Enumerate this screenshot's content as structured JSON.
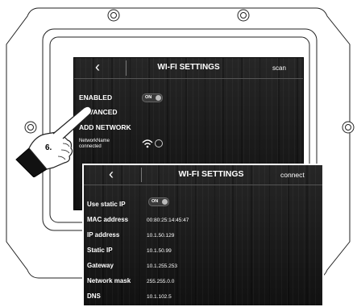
{
  "screen1": {
    "title": "WI-FI SETTINGS",
    "scan_label": "scan",
    "rows": {
      "enabled": "ENABLED",
      "advanced": "ADVANCED",
      "add_network": "ADD NETWORK",
      "network_name": "NetworkName",
      "connected": "connected"
    },
    "toggle_label": "ON"
  },
  "screen2": {
    "title": "WI-FI SETTINGS",
    "connect_label": "connect",
    "static_ip_label": "Use static IP",
    "toggle_label": "ON",
    "fields": [
      {
        "label": "MAC address",
        "value": "00:80:25:14:45:47"
      },
      {
        "label": "IP address",
        "value": "10.1.50.129"
      },
      {
        "label": "Static IP",
        "value": "10.1.50.99"
      },
      {
        "label": "Gateway",
        "value": "10.1.255.253"
      },
      {
        "label": "Network mask",
        "value": "255.255.0.0"
      },
      {
        "label": "DNS",
        "value": "10.1.102.5"
      }
    ]
  },
  "callout": {
    "step": "6."
  }
}
